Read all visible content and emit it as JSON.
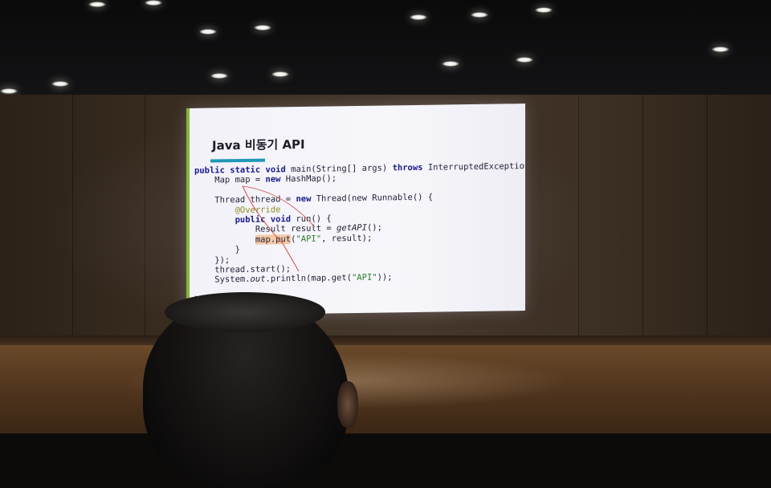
{
  "slide": {
    "title": "Java 비동기 API",
    "accent_color": "#86b437",
    "underline_color": "#1f98b8",
    "code": {
      "l1_kw": "public static void",
      "l1_text": " main(String[] args) ",
      "l1_kw2": "throws",
      "l1_text2": " InterruptedException {",
      "l2_text": "    Map map = ",
      "l2_kw": "new",
      "l2_text2": " HashMap();",
      "l3_text": "    Thread thread = ",
      "l3_kw": "new",
      "l3_text2": " Thread(new Runnable() {",
      "l4_ann": "        @Override",
      "l5_kw": "        public void",
      "l5_text": " run() {",
      "l6_text": "            Result result = ",
      "l6_it": "getAPI",
      "l6_text2": "();",
      "l7_hl": "map.put",
      "l7_str": "\"API\"",
      "l7_text": ", result);",
      "l8_text": "        }",
      "l9_text": "    });",
      "l10_text": "    thread.start();",
      "l11_text": "    System.",
      "l11_it": "out",
      "l11_text2": ".println(map.get(",
      "l11_str": "\"API\"",
      "l11_text3": "));",
      "l12_text": "}"
    }
  }
}
